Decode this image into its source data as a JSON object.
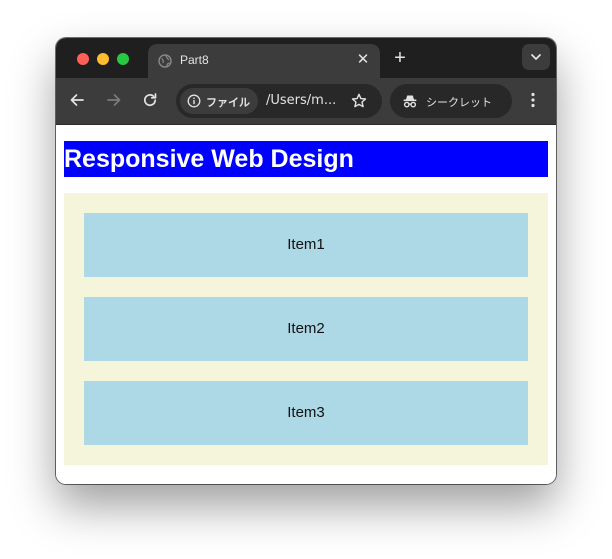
{
  "browser": {
    "tab": {
      "title": "Part8"
    },
    "address": {
      "security_chip": "ファイル",
      "url": "/Users/m..."
    },
    "incognito_label": "シークレット"
  },
  "page": {
    "heading": "Responsive Web Design",
    "items": [
      "Item1",
      "Item2",
      "Item3"
    ]
  },
  "colors": {
    "heading_background": "#0000ff",
    "heading_text": "#ffffff",
    "container_background": "#f5f5dc",
    "item_background": "#add8e6"
  },
  "icons": [
    "globe-icon",
    "close-icon",
    "plus-icon",
    "chevron-down-icon",
    "back-icon",
    "forward-icon",
    "reload-icon",
    "info-icon",
    "star-icon",
    "incognito-icon",
    "more-icon"
  ]
}
